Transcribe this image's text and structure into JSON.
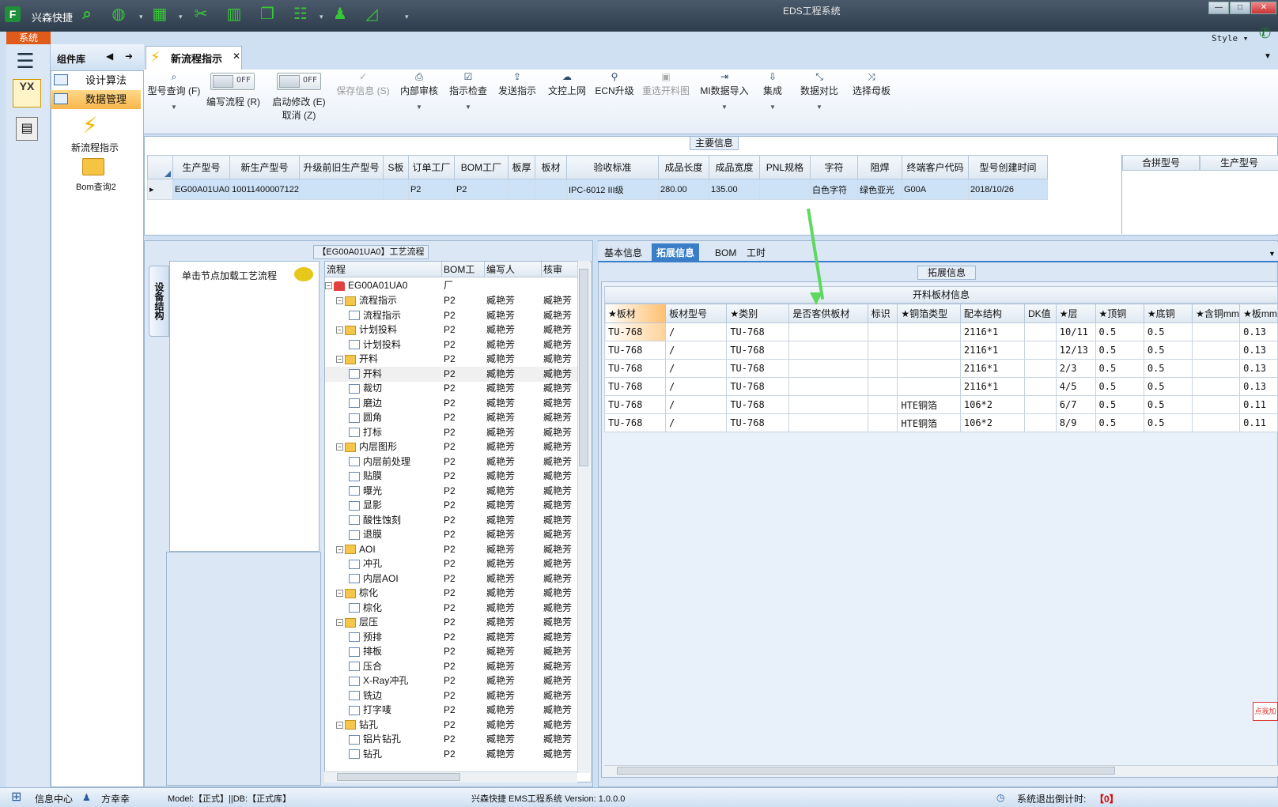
{
  "app": {
    "name": "兴森快捷",
    "window_title": "EDS工程系统",
    "system_tab": "系统",
    "style_label": "Style"
  },
  "quick_access": [
    "search-icon",
    "globe-icon",
    "grid-icon",
    "scissors-icon",
    "film-icon",
    "copy-icon",
    "table-icon",
    "user-icon",
    "chart-icon"
  ],
  "left_nav": {
    "panel_title": "组件库",
    "items": [
      "设计算法",
      "数据管理"
    ],
    "icons": [
      {
        "label": "新流程指示"
      },
      {
        "label": "Bom查询2"
      }
    ],
    "yx_label": "YX"
  },
  "document_tab": {
    "label": "新流程指示"
  },
  "toolbar": {
    "buttons": [
      {
        "label": "型号查询 (F)",
        "icon": "search-icon"
      },
      {
        "label": "编写流程 (R)",
        "toggle": "OFF"
      },
      {
        "label": "启动修改 (E)",
        "label2": "取消 (Z)",
        "toggle": "OFF"
      },
      {
        "label": "保存信息 (S)",
        "disabled": true
      },
      {
        "label": "内部审核"
      },
      {
        "label": "指示检查"
      },
      {
        "label": "发送指示"
      },
      {
        "label": "文控上网"
      },
      {
        "label": "ECN升级"
      },
      {
        "label": "重选开料图",
        "disabled": true
      },
      {
        "label": "MI数据导入"
      },
      {
        "label": "集成"
      },
      {
        "label": "数据对比"
      },
      {
        "label": "选择母板"
      }
    ]
  },
  "main_info": {
    "title": "主要信息",
    "columns": [
      "生产型号",
      "新生产型号",
      "升级前旧生产型号",
      "S板",
      "订单工厂",
      "BOM工厂",
      "板厚",
      "板材",
      "验收标准",
      "成品长度",
      "成品宽度",
      "PNL规格",
      "字符",
      "阻焊",
      "终端客户代码",
      "型号创建时间"
    ],
    "rows": [
      [
        "EG00A01UA0",
        "10011400007122",
        "",
        "",
        "P2",
        "P2",
        "",
        "",
        "IPC-6012 III级",
        "280.00",
        "135.00",
        "",
        "白色字符",
        "绿色亚光",
        "G00A",
        "2018/10/26"
      ]
    ],
    "merge_columns": [
      "合拼型号",
      "生产型号"
    ]
  },
  "process": {
    "title": "【EG00A01UA0】工艺流程",
    "side_tab": "设备结构",
    "node_hint": "单击节点加载工艺流程",
    "columns": [
      "流程",
      "BOM工厂",
      "编写人",
      "核审"
    ],
    "root": "EG00A01UA0",
    "rows": [
      {
        "name": "流程指示",
        "level": 1,
        "factory": "P2",
        "writer": "臧艳芳",
        "review": "臧艳芳"
      },
      {
        "name": "流程指示",
        "level": 2,
        "factory": "P2",
        "writer": "臧艳芳",
        "review": "臧艳芳"
      },
      {
        "name": "计划投料",
        "level": 1,
        "factory": "P2",
        "writer": "臧艳芳",
        "review": "臧艳芳"
      },
      {
        "name": "计划投料",
        "level": 2,
        "factory": "P2",
        "writer": "臧艳芳",
        "review": "臧艳芳"
      },
      {
        "name": "开料",
        "level": 1,
        "factory": "P2",
        "writer": "臧艳芳",
        "review": "臧艳芳"
      },
      {
        "name": "开料",
        "level": 2,
        "factory": "P2",
        "writer": "臧艳芳",
        "review": "臧艳芳",
        "selected": true
      },
      {
        "name": "裁切",
        "level": 2,
        "factory": "P2",
        "writer": "臧艳芳",
        "review": "臧艳芳"
      },
      {
        "name": "磨边",
        "level": 2,
        "factory": "P2",
        "writer": "臧艳芳",
        "review": "臧艳芳"
      },
      {
        "name": "圆角",
        "level": 2,
        "factory": "P2",
        "writer": "臧艳芳",
        "review": "臧艳芳"
      },
      {
        "name": "打标",
        "level": 2,
        "factory": "P2",
        "writer": "臧艳芳",
        "review": "臧艳芳"
      },
      {
        "name": "内层图形",
        "level": 1,
        "factory": "P2",
        "writer": "臧艳芳",
        "review": "臧艳芳"
      },
      {
        "name": "内层前处理",
        "level": 2,
        "factory": "P2",
        "writer": "臧艳芳",
        "review": "臧艳芳"
      },
      {
        "name": "贴膜",
        "level": 2,
        "factory": "P2",
        "writer": "臧艳芳",
        "review": "臧艳芳"
      },
      {
        "name": "曝光",
        "level": 2,
        "factory": "P2",
        "writer": "臧艳芳",
        "review": "臧艳芳"
      },
      {
        "name": "显影",
        "level": 2,
        "factory": "P2",
        "writer": "臧艳芳",
        "review": "臧艳芳"
      },
      {
        "name": "酸性蚀刻",
        "level": 2,
        "factory": "P2",
        "writer": "臧艳芳",
        "review": "臧艳芳"
      },
      {
        "name": "退膜",
        "level": 2,
        "factory": "P2",
        "writer": "臧艳芳",
        "review": "臧艳芳"
      },
      {
        "name": "AOI",
        "level": 1,
        "factory": "P2",
        "writer": "臧艳芳",
        "review": "臧艳芳"
      },
      {
        "name": "冲孔",
        "level": 2,
        "factory": "P2",
        "writer": "臧艳芳",
        "review": "臧艳芳"
      },
      {
        "name": "内层AOI",
        "level": 2,
        "factory": "P2",
        "writer": "臧艳芳",
        "review": "臧艳芳"
      },
      {
        "name": "棕化",
        "level": 1,
        "factory": "P2",
        "writer": "臧艳芳",
        "review": "臧艳芳"
      },
      {
        "name": "棕化",
        "level": 2,
        "factory": "P2",
        "writer": "臧艳芳",
        "review": "臧艳芳"
      },
      {
        "name": "层压",
        "level": 1,
        "factory": "P2",
        "writer": "臧艳芳",
        "review": "臧艳芳"
      },
      {
        "name": "预排",
        "level": 2,
        "factory": "P2",
        "writer": "臧艳芳",
        "review": "臧艳芳"
      },
      {
        "name": "排板",
        "level": 2,
        "factory": "P2",
        "writer": "臧艳芳",
        "review": "臧艳芳"
      },
      {
        "name": "压合",
        "level": 2,
        "factory": "P2",
        "writer": "臧艳芳",
        "review": "臧艳芳"
      },
      {
        "name": "X-Ray冲孔",
        "level": 2,
        "factory": "P2",
        "writer": "臧艳芳",
        "review": "臧艳芳"
      },
      {
        "name": "铣边",
        "level": 2,
        "factory": "P2",
        "writer": "臧艳芳",
        "review": "臧艳芳"
      },
      {
        "name": "打字唛",
        "level": 2,
        "factory": "P2",
        "writer": "臧艳芳",
        "review": "臧艳芳"
      },
      {
        "name": "钻孔",
        "level": 1,
        "factory": "P2",
        "writer": "臧艳芳",
        "review": "臧艳芳"
      },
      {
        "name": "铝片钻孔",
        "level": 2,
        "factory": "P2",
        "writer": "臧艳芳",
        "review": "臧艳芳"
      },
      {
        "name": "钻孔",
        "level": 2,
        "factory": "P2",
        "writer": "臧艳芳",
        "review": "臧艳芳"
      }
    ]
  },
  "detail_tabs": [
    "基本信息",
    "拓展信息",
    "BOM",
    "工时"
  ],
  "extended": {
    "title": "拓展信息",
    "grid_title": "开料板材信息",
    "columns": [
      "★板材",
      "板材型号",
      "★类别",
      "是否客供板材",
      "标识",
      "★铜箔类型",
      "配本结构",
      "DK值",
      "★层",
      "★顶铜",
      "★底铜",
      "★含铜mm",
      "★板mm"
    ],
    "rows": [
      [
        "TU-768",
        "/",
        "TU-768",
        "",
        "",
        "",
        "2116*1",
        "",
        "10/11",
        "0.5",
        "0.5",
        "",
        "0.13"
      ],
      [
        "TU-768",
        "/",
        "TU-768",
        "",
        "",
        "",
        "2116*1",
        "",
        "12/13",
        "0.5",
        "0.5",
        "",
        "0.13"
      ],
      [
        "TU-768",
        "/",
        "TU-768",
        "",
        "",
        "",
        "2116*1",
        "",
        "2/3",
        "0.5",
        "0.5",
        "",
        "0.13"
      ],
      [
        "TU-768",
        "/",
        "TU-768",
        "",
        "",
        "",
        "2116*1",
        "",
        "4/5",
        "0.5",
        "0.5",
        "",
        "0.13"
      ],
      [
        "TU-768",
        "/",
        "TU-768",
        "",
        "",
        "HTE铜箔",
        "106*2",
        "",
        "6/7",
        "0.5",
        "0.5",
        "",
        "0.11"
      ],
      [
        "TU-768",
        "/",
        "TU-768",
        "",
        "",
        "HTE铜箔",
        "106*2",
        "",
        "8/9",
        "0.5",
        "0.5",
        "",
        "0.11"
      ]
    ]
  },
  "side_widget": "点我加",
  "status": {
    "info_center": "信息中心",
    "user": "方幸幸",
    "model": "Model:【正式】||DB:【正式库】",
    "version": "兴森快捷 EMS工程系统 Version: 1.0.0.0",
    "logout_label": "系统退出倒计时:",
    "logout_value": "【0】"
  }
}
